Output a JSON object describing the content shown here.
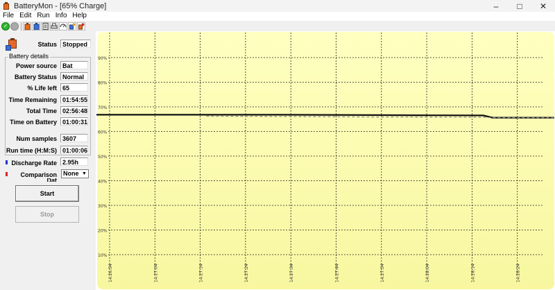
{
  "window": {
    "title": "BatteryMon - [65% Charge]"
  },
  "menu": [
    "File",
    "Edit",
    "Run",
    "Info",
    "Help"
  ],
  "toolbar": {
    "icons": [
      "start-icon",
      "stop-icon",
      "battery-icon",
      "battery-info-icon",
      "log-icon",
      "print-icon",
      "chart-icon",
      "settings-icon",
      "power-icon"
    ]
  },
  "panel": {
    "status_label": "Status",
    "status_value": "Stopped",
    "group_title": "Battery details",
    "power_source_label": "Power source",
    "power_source_value": "Bat",
    "battery_status_label": "Battery Status",
    "battery_status_value": "Normal",
    "life_left_label": "% Life left",
    "life_left_value": "65",
    "time_remaining_label": "Time Remaining",
    "time_remaining_value": "01:54:55",
    "total_time_label": "Total Time",
    "total_time_value": "02:56:48",
    "time_on_battery_label": "Time on Battery",
    "time_on_battery_value": "01:00:31",
    "num_samples_label": "Num samples",
    "num_samples_value": "3607",
    "run_time_label": "Run time (H:M:S)",
    "run_time_value": "01:00:06",
    "discharge_rate_label": "Discharge Rate",
    "discharge_rate_value": "2.95h",
    "comparison_label": "Comparison",
    "comparison_label_partial": "Dat",
    "comparison_value": "None",
    "start_label": "Start",
    "stop_label": "Stop"
  },
  "colors": {
    "discharge_marker": "#2233cc",
    "comparison_marker": "#dd2222",
    "chart_top": "#ffffc0",
    "chart_bottom": "#f8f7a0"
  },
  "chart_data": {
    "type": "line",
    "ylim": [
      10,
      92
    ],
    "y_ticks": [
      "90%",
      "80%",
      "70%",
      "60%",
      "50%",
      "40%",
      "30%",
      "20%",
      "10%"
    ],
    "x_ticks": [
      "14:26:54",
      "14:27:04",
      "14:27:14",
      "14:27:24",
      "14:27:34",
      "14:27:44",
      "14:27:54",
      "14:28:04",
      "14:28:14",
      "14:28:24"
    ],
    "grid": true,
    "series": [
      {
        "style": "solid",
        "color": "#111111",
        "points": [
          [
            0,
            66.8
          ],
          [
            0.4,
            66.8
          ],
          [
            0.7,
            66.6
          ],
          [
            0.845,
            66.5
          ],
          [
            0.865,
            65.6
          ],
          [
            1.0,
            65.6
          ]
        ]
      },
      {
        "style": "dashed",
        "color": "#888888",
        "points": [
          [
            0.24,
            66.2
          ],
          [
            0.4,
            66.1
          ],
          [
            0.6,
            65.9
          ],
          [
            0.845,
            65.8
          ],
          [
            0.865,
            65.6
          ],
          [
            1.0,
            65.6
          ]
        ]
      }
    ]
  }
}
